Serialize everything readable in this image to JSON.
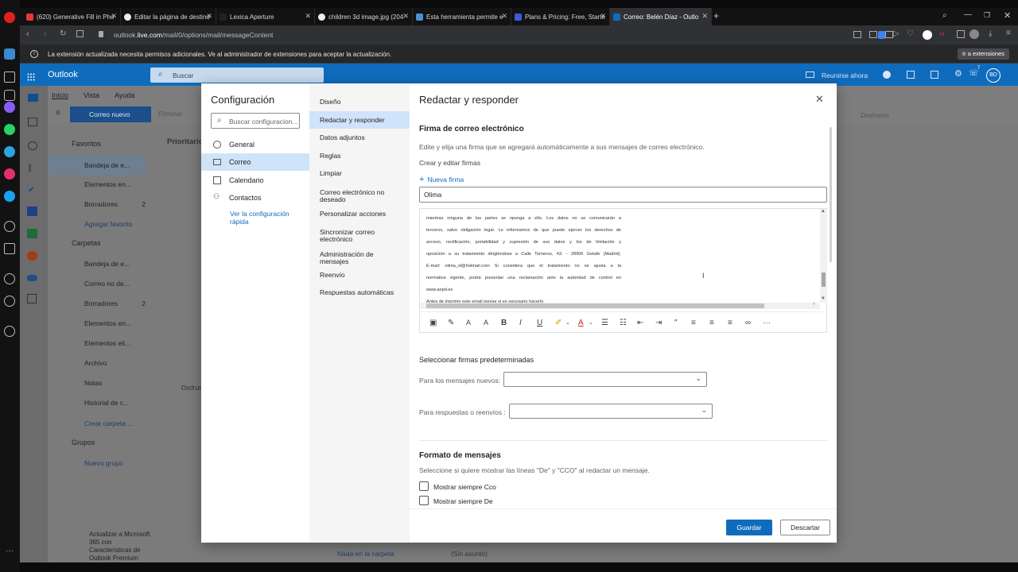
{
  "browser": {
    "tabs": [
      {
        "label": "(620) Generative Fill in Pho",
        "color": "#e53935"
      },
      {
        "label": "Editar la página de destino",
        "color": "#eeeeee"
      },
      {
        "label": "Lexica Aperture",
        "color": "#222222"
      },
      {
        "label": "children 3d image.jpg (204",
        "color": "#eeeeee"
      },
      {
        "label": "Esta herramienta permite e",
        "color": "#4a90d9"
      },
      {
        "label": "Plans & Pricing: Free, Starte",
        "color": "#3b5bdb"
      },
      {
        "label": "Correo: Belén Díaz - Outlo",
        "color": "#0f6cbd"
      }
    ],
    "url_prefix": "outlook.",
    "url_domain": "live.com",
    "url_path": "/mail/0/options/mail/messageContent",
    "extension_message": "La extensión actualizada necesita permisos adicionales. Ve al administrador de extensiones para aceptar la actualización.",
    "extension_button": "Ir a extensiones"
  },
  "outlook": {
    "brand": "Outlook",
    "search_placeholder": "Buscar",
    "meet_now": "Reunirse ahora",
    "avatar_initials": "BD",
    "notification_count": "7",
    "ribbon_tabs": [
      "Inicio",
      "Vista",
      "Ayuda"
    ],
    "new_mail": "Correo nuevo",
    "delete": "Eliminar",
    "undo": "Deshacer",
    "focused_tab": "Prioritario",
    "favorites_header": "Favoritos",
    "favorites": [
      {
        "label": "Bandeja de e...",
        "count": ""
      },
      {
        "label": "Elementos en...",
        "count": ""
      },
      {
        "label": "Borradores",
        "count": "2"
      }
    ],
    "add_favorite": "Agregar favorito",
    "folders_header": "Carpetas",
    "folders": [
      {
        "label": "Bandeja de e...",
        "count": ""
      },
      {
        "label": "Correo no de...",
        "count": ""
      },
      {
        "label": "Borradores",
        "count": "2"
      },
      {
        "label": "Elementos en...",
        "count": ""
      },
      {
        "label": "Elementos eli...",
        "count": ""
      },
      {
        "label": "Archivo",
        "count": ""
      },
      {
        "label": "Notas",
        "count": ""
      },
      {
        "label": "Historial de c...",
        "count": ""
      }
    ],
    "create_folder": "Crear carpeta ...",
    "groups_header": "Grupos",
    "new_group": "Nuevo grupo",
    "upgrade_text": "Actualizar a Microsoft 365 con Características de Outlook Premium",
    "empty_folder": "Nada en la carpeta",
    "draft_subject": "(Sin asunto)",
    "disfruta": "Disfrut"
  },
  "settings": {
    "title": "Configuración",
    "search_placeholder": "Buscar configuracion...",
    "categories": [
      {
        "label": "General"
      },
      {
        "label": "Correo"
      },
      {
        "label": "Calendario"
      },
      {
        "label": "Contactos"
      }
    ],
    "quick_settings": "Ver la configuración rápida",
    "mail_sections": [
      "Diseño",
      "Redactar y responder",
      "Datos adjuntos",
      "Reglas",
      "Limpiar",
      "Correo electrónico no deseado",
      "Personalizar acciones",
      "Sincronizar correo electrónico",
      "Administración de mensajes",
      "Reenvío",
      "Respuestas automáticas"
    ]
  },
  "compose": {
    "title": "Redactar y responder",
    "signature_heading": "Firma de correo electrónico",
    "signature_desc": "Edite y elija una firma que se agregará automáticamente a sus mensajes de correo electrónico.",
    "create_edit": "Crear y editar firmas",
    "new_signature": "Nueva firma",
    "signature_name": "Olima",
    "signature_lines": [
      "mientras ninguna de las partes se oponga a ello. Los datos no se comunicarán a",
      "terceros, salvo obligación legal. Le informamos de que puede ejercer los derechos de",
      "acceso, rectificación, portabilidad y supresión de sus datos y los de limitación y",
      "oposición a su tratamiento dirigiéndose a Calle Torneros, 43. - 28906 Getafe (Madrid).",
      "E-mail: olima_sl@hotmail.com  Si considera que el tratamiento no se ajusta a la",
      "normativa vigente, podrá presentar una reclamación ante la autoridad de control en",
      "www.aepd.es",
      "Antes de imprimir este email piense si es necesario hacerlo"
    ],
    "default_heading": "Seleccionar firmas predeterminadas",
    "new_messages_label": "Para los mensajes nuevos:",
    "new_messages_value": "",
    "replies_label": "Para respuestas o reenvíos :",
    "replies_value": "",
    "format_heading": "Formato de mensajes",
    "format_desc": "Seleccione si quiere mostrar las líneas \"De\" y \"CCO\" al redactar un mensaje.",
    "show_bcc": "Mostrar siempre Cco",
    "show_from": "Mostrar siempre De",
    "save": "Guardar",
    "discard": "Descartar"
  }
}
